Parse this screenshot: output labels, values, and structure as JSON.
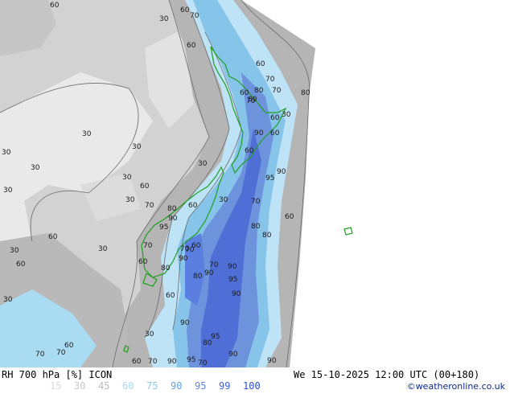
{
  "map": {
    "contour_labels": [
      "60",
      "30",
      "60",
      "70",
      "60",
      "60",
      "70",
      "80",
      "70",
      "60",
      "80",
      "70",
      "30",
      "60",
      "60",
      "80",
      "90",
      "60",
      "30",
      "30",
      "30",
      "30",
      "30",
      "60",
      "30",
      "30",
      "60",
      "30",
      "90",
      "95",
      "70",
      "60",
      "80",
      "70",
      "90",
      "80",
      "60",
      "60",
      "70",
      "70",
      "60",
      "80",
      "90",
      "30",
      "95",
      "70",
      "90",
      "80",
      "90",
      "90",
      "80",
      "95",
      "90",
      "30",
      "60",
      "95",
      "90",
      "70",
      "80",
      "70",
      "70",
      "60",
      "60",
      "70",
      "90",
      "95",
      "70",
      "90",
      "30",
      "30",
      "30",
      "60"
    ],
    "colors": {
      "background": "#e9e9e9",
      "rh_30_60": "#c9c9c9",
      "rh_60": "#b2b2b2",
      "rh_75": "#bfe3f6",
      "rh_90": "#7fbfe8",
      "rh_95": "#6d93dc",
      "rh_99": "#4f6fd6",
      "coastline": "#1fa01f",
      "ocean_right": "#ffffff"
    }
  },
  "footer": {
    "title": "RH 700 hPa [%] ICON",
    "datetime": "We 15-10-2025 12:00 UTC (00+180)",
    "credit": "©weatheronline.co.uk",
    "legend": [
      {
        "value": "15",
        "color": "#d8d8d8"
      },
      {
        "value": "30",
        "color": "#c8c8c8"
      },
      {
        "value": "45",
        "color": "#b9b9b9"
      },
      {
        "value": "60",
        "color": "#a9dcf2"
      },
      {
        "value": "75",
        "color": "#8ccbf0"
      },
      {
        "value": "90",
        "color": "#5fa4ea"
      },
      {
        "value": "95",
        "color": "#5a86e3"
      },
      {
        "value": "99",
        "color": "#3d62e0"
      },
      {
        "value": "100",
        "color": "#2a4dd8"
      }
    ]
  }
}
